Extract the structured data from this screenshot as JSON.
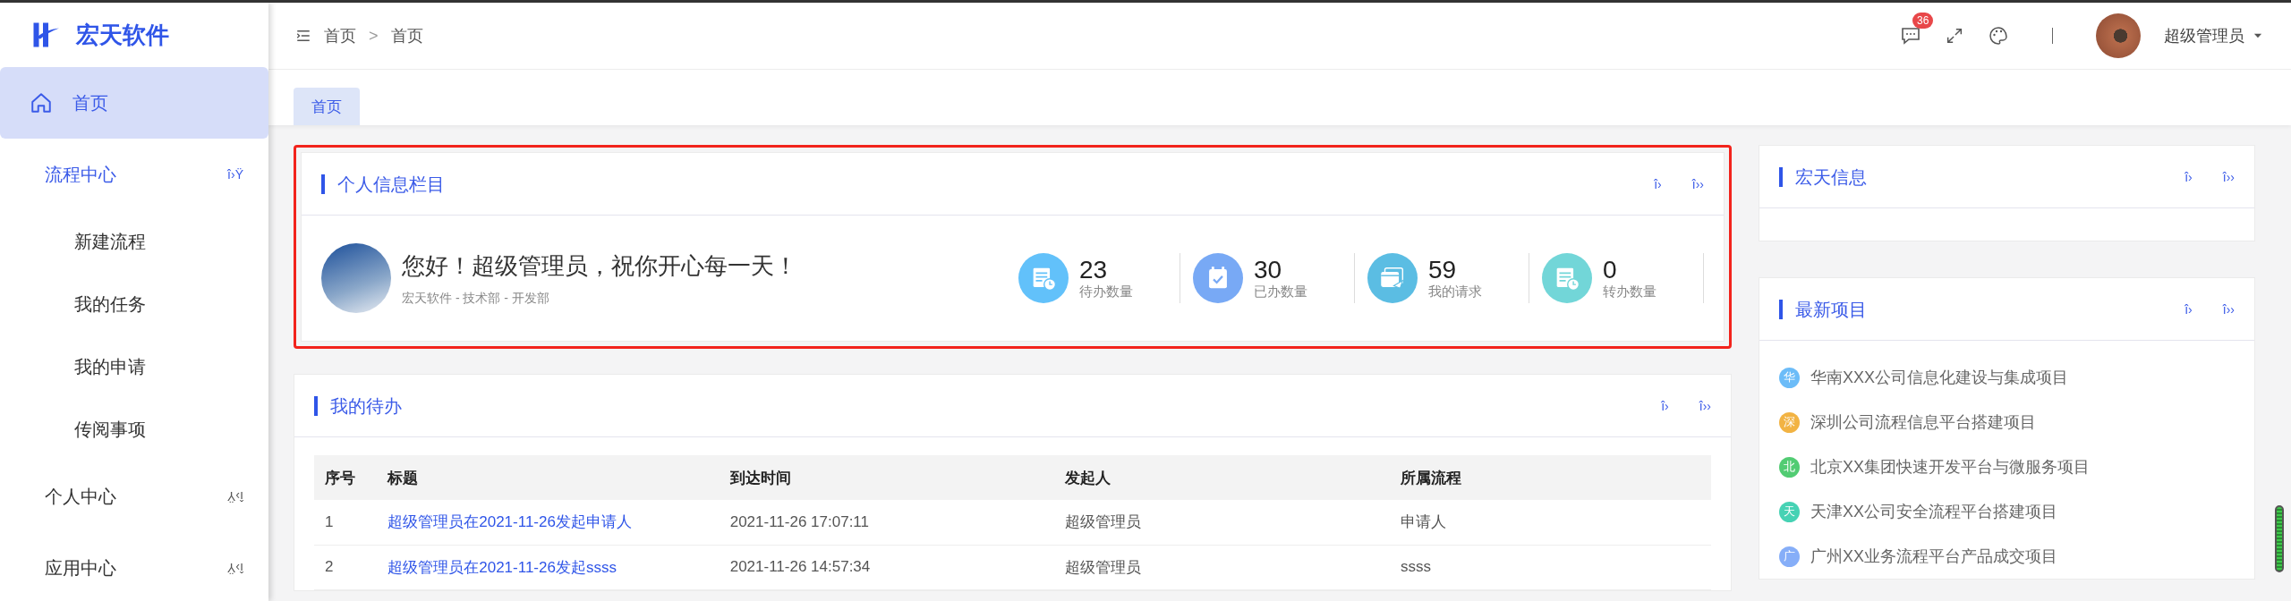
{
  "logo": {
    "text": "宏天软件"
  },
  "sidebar": {
    "items": [
      {
        "label": "首页",
        "kind": "home",
        "selected": true
      },
      {
        "label": "流程中心",
        "kind": "group",
        "expanded": true,
        "toggle": "î›Ÿ",
        "children": [
          {
            "label": "新建流程"
          },
          {
            "label": "我的任务"
          },
          {
            "label": "我的申请"
          },
          {
            "label": "传阅事项"
          }
        ]
      },
      {
        "label": "个人中心",
        "kind": "group",
        "expanded": false,
        "toggle": "î›Ÿ"
      },
      {
        "label": "应用中心",
        "kind": "group",
        "expanded": false,
        "toggle": "î›Ÿ"
      }
    ]
  },
  "breadcrumb": [
    "首页",
    "首页"
  ],
  "breadcrumb_separator": ">",
  "header": {
    "message_badge": "36",
    "user_name": "超级管理员"
  },
  "tabs": [
    {
      "label": "首页",
      "selected": true
    }
  ],
  "profile_card": {
    "title": "个人信息栏目",
    "highlighted": true,
    "actions": [
      "î›",
      "î››"
    ],
    "greeting": "您好！超级管理员，祝你开心每一天！",
    "org": "宏天软件 - 技术部 - 开发部",
    "stats": [
      {
        "kind": "pending",
        "value": "23",
        "label": "待办数量",
        "color": "#62c1fa"
      },
      {
        "kind": "done",
        "value": "30",
        "label": "已办数量",
        "color": "#78a9f5"
      },
      {
        "kind": "request",
        "value": "59",
        "label": "我的请求",
        "color": "#5bbde3"
      },
      {
        "kind": "transfer",
        "value": "0",
        "label": "转办数量",
        "color": "#72d6d8"
      }
    ]
  },
  "todo_card": {
    "title": "我的待办",
    "actions": [
      "î›",
      "î››"
    ],
    "table": {
      "columns": [
        "序号",
        "标题",
        "到达时间",
        "发起人",
        "所属流程"
      ],
      "rows": [
        [
          "1",
          "超级管理员在2021-11-26发起申请人",
          "2021-11-26 17:07:11",
          "超级管理员",
          "申请人"
        ],
        [
          "2",
          "超级管理员在2021-11-26发起ssss",
          "2021-11-26 14:57:34",
          "超级管理员",
          "ssss"
        ]
      ]
    }
  },
  "info_card": {
    "title": "宏天信息",
    "actions": [
      "î›",
      "î››"
    ]
  },
  "projects_card": {
    "title": "最新项目",
    "actions": [
      "î›",
      "î››"
    ],
    "items": [
      {
        "badge": "华",
        "text": "华南XXX公司信息化建设与集成项目",
        "color": "#6cbcf8"
      },
      {
        "badge": "深",
        "text": "深圳公司流程信息平台搭建项目",
        "color": "#f2b343"
      },
      {
        "badge": "北",
        "text": "北京XX集团快速开发平台与微服务项目",
        "color": "#52cc73"
      },
      {
        "badge": "天",
        "text": "天津XX公司安全流程平台搭建项目",
        "color": "#46d2b4"
      },
      {
        "badge": "广",
        "text": "广州XX业务流程平台产品成交项目",
        "color": "#86aef8"
      }
    ]
  }
}
